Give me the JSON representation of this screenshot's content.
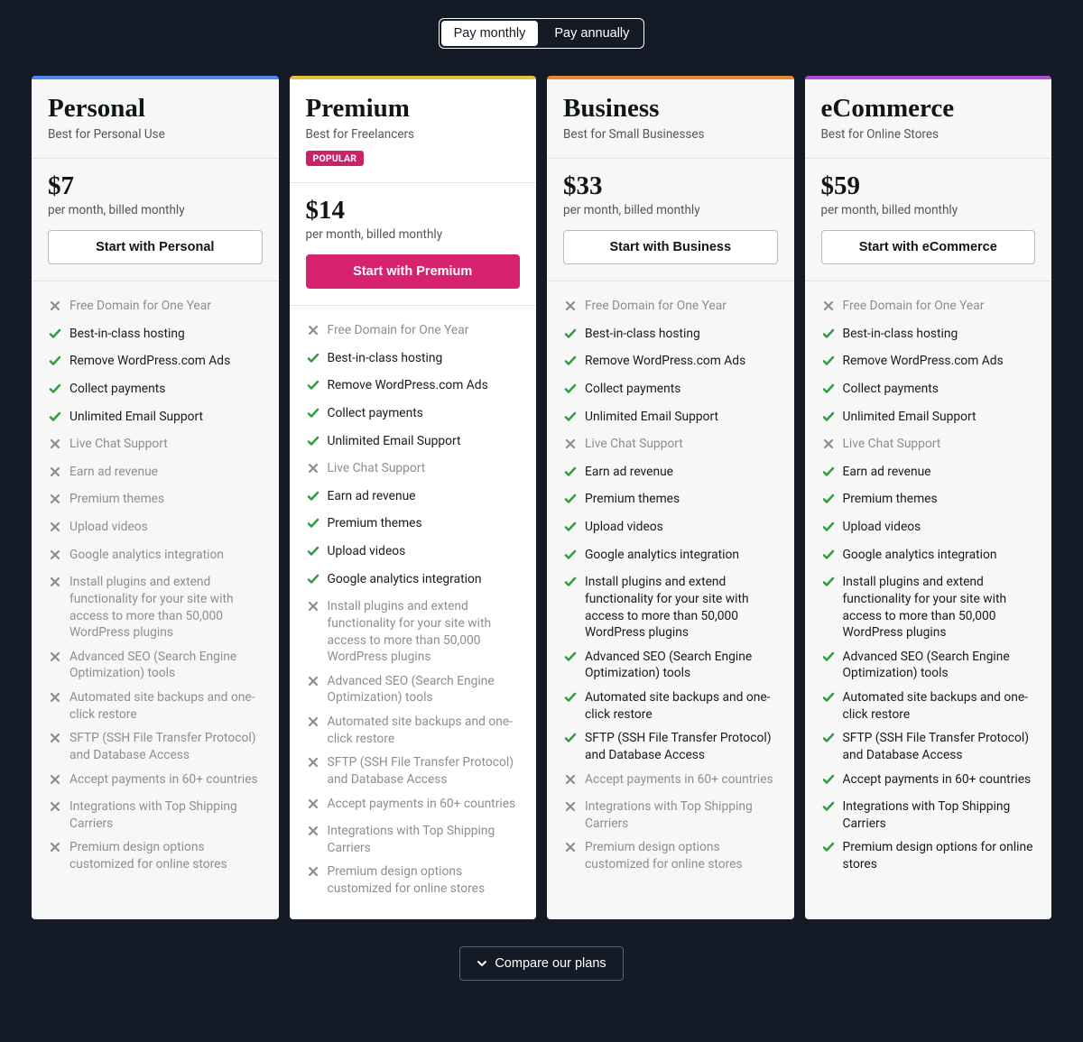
{
  "billing": {
    "monthly": "Pay monthly",
    "annually": "Pay annually",
    "active": "monthly"
  },
  "feature_labels": [
    "Free Domain for One Year",
    "Best-in-class hosting",
    "Remove WordPress.com Ads",
    "Collect payments",
    "Unlimited Email Support",
    "Live Chat Support",
    "Earn ad revenue",
    "Premium themes",
    "Upload videos",
    "Google analytics integration",
    "Install plugins and extend functionality for your site with access to more than 50,000 WordPress plugins",
    "Advanced SEO (Search Engine Optimization) tools",
    "Automated site backups and one-click restore",
    "SFTP (SSH File Transfer Protocol) and Database Access",
    "Accept payments in 60+ countries",
    "Integrations with Top Shipping Carriers",
    "Premium design options customized for online stores"
  ],
  "ecommerce_last_feature": "Premium design options for online stores",
  "popular_label": "POPULAR",
  "plans": [
    {
      "id": "personal",
      "name": "Personal",
      "tagline": "Best for Personal Use",
      "price": "$7",
      "period": "per month, billed monthly",
      "cta": "Start with Personal",
      "accent": "#4d8af0",
      "popular": false,
      "included": [
        false,
        true,
        true,
        true,
        true,
        false,
        false,
        false,
        false,
        false,
        false,
        false,
        false,
        false,
        false,
        false,
        false
      ]
    },
    {
      "id": "premium",
      "name": "Premium",
      "tagline": "Best for Freelancers",
      "price": "$14",
      "period": "per month, billed monthly",
      "cta": "Start with Premium",
      "accent": "#e3c23b",
      "popular": true,
      "included": [
        false,
        true,
        true,
        true,
        true,
        false,
        true,
        true,
        true,
        true,
        false,
        false,
        false,
        false,
        false,
        false,
        false
      ]
    },
    {
      "id": "business",
      "name": "Business",
      "tagline": "Best for Small Businesses",
      "price": "$33",
      "period": "per month, billed monthly",
      "cta": "Start with Business",
      "accent": "#e68a2e",
      "popular": false,
      "included": [
        false,
        true,
        true,
        true,
        true,
        false,
        true,
        true,
        true,
        true,
        true,
        true,
        true,
        true,
        false,
        false,
        false
      ]
    },
    {
      "id": "ecommerce",
      "name": "eCommerce",
      "tagline": "Best for Online Stores",
      "price": "$59",
      "period": "per month, billed monthly",
      "cta": "Start with eCommerce",
      "accent": "#b24dd8",
      "popular": false,
      "included": [
        false,
        true,
        true,
        true,
        true,
        false,
        true,
        true,
        true,
        true,
        true,
        true,
        true,
        true,
        true,
        true,
        true
      ]
    }
  ],
  "compare_label": "Compare our plans"
}
